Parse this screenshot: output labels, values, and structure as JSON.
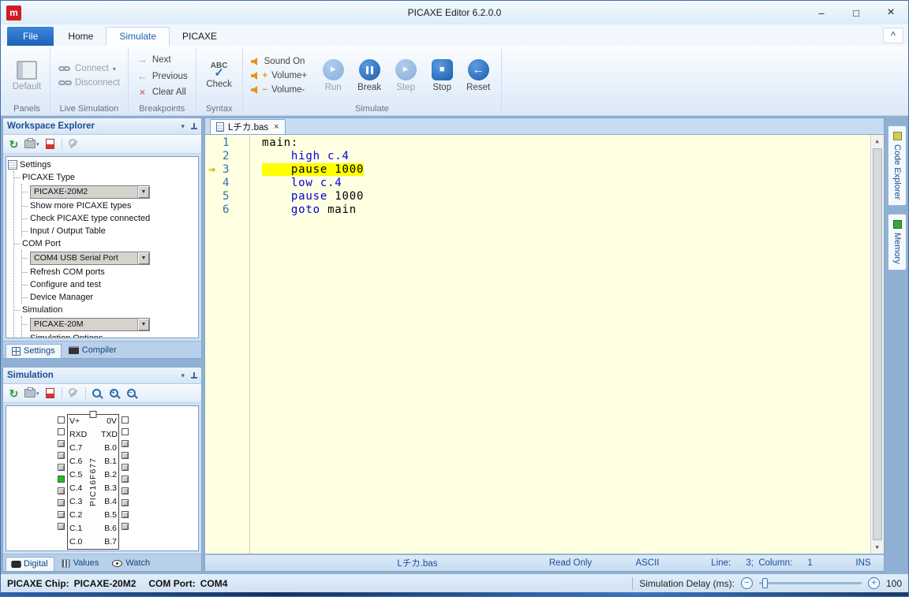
{
  "window": {
    "title": "PICAXE Editor 6.2.0.0"
  },
  "icons": {
    "app_logo": "m",
    "minimize": "–",
    "maximize": "□",
    "close": "×",
    "ribbon_collapse": "^",
    "dropdown": "▼",
    "panel_menu": "▾",
    "connect_caret": "▾",
    "printer_caret": "▾",
    "next": "→",
    "previous": "←",
    "clear_all": "×",
    "check": "✓",
    "run": "►",
    "step": "►",
    "stop": "■",
    "reset": "←",
    "refresh": "↻",
    "scroll_up": "▲",
    "scroll_down": "▼",
    "minus": "−",
    "plus": "+",
    "tab_close": "×",
    "zoom_plus": "+",
    "zoom_minus": "−"
  },
  "colors": {
    "accent_blue": "#1c5cab",
    "editor_bg": "#ffffe1",
    "line_highlight": "#ffff00",
    "keyword_blue": "#0000dd",
    "pin_on_green": "#17c517",
    "file_tab_blue": "#2273cc"
  },
  "ribbon": {
    "tabs": {
      "file": "File",
      "home": "Home",
      "simulate": "Simulate",
      "picaxe": "PICAXE"
    },
    "panels": {
      "default_label": "Default",
      "group_label": "Panels"
    },
    "live_simulation": {
      "connect": "Connect",
      "disconnect": "Disconnect",
      "group_label": "Live Simulation"
    },
    "breakpoints": {
      "next": "Next",
      "previous": "Previous",
      "clear_all": "Clear All",
      "group_label": "Breakpoints"
    },
    "syntax": {
      "abc": "ABC",
      "check": "Check",
      "group_label": "Syntax"
    },
    "simulate_group": {
      "sound_on": "Sound On",
      "volume_up": "Volume+",
      "volume_down": "Volume-",
      "run": "Run",
      "break": "Break",
      "step": "Step",
      "stop": "Stop",
      "reset": "Reset",
      "group_label": "Simulate"
    }
  },
  "workspace": {
    "title": "Workspace Explorer",
    "tree": {
      "root": "Settings",
      "picaxe_type": {
        "label": "PICAXE Type",
        "combo": "PICAXE-20M2",
        "items": [
          "Show more PICAXE types",
          "Check PICAXE type connected",
          "Input / Output Table"
        ]
      },
      "com_port": {
        "label": "COM Port",
        "combo": "COM4 USB Serial Port",
        "items": [
          "Refresh COM ports",
          "Configure and test",
          "Device Manager"
        ]
      },
      "simulation": {
        "label": "Simulation",
        "combo": "PICAXE-20M",
        "items": [
          "Simulation Options"
        ]
      }
    },
    "tabs": {
      "settings": "Settings",
      "compiler": "Compiler"
    }
  },
  "simulation_panel": {
    "title": "Simulation",
    "chip": {
      "name": "PIC16F677",
      "pins": [
        {
          "left": "V+",
          "right": "0V",
          "lstate": "io",
          "rstate": "io"
        },
        {
          "left": "RXD",
          "right": "TXD",
          "lstate": "io",
          "rstate": "io"
        },
        {
          "left": "C.7",
          "right": "B.0",
          "lstate": "off",
          "rstate": "off"
        },
        {
          "left": "C.6",
          "right": "B.1",
          "lstate": "off",
          "rstate": "off"
        },
        {
          "left": "C.5",
          "right": "B.2",
          "lstate": "off",
          "rstate": "off"
        },
        {
          "left": "C.4",
          "right": "B.3",
          "lstate": "on",
          "rstate": "off"
        },
        {
          "left": "C.3",
          "right": "B.4",
          "lstate": "off",
          "rstate": "off"
        },
        {
          "left": "C.2",
          "right": "B.5",
          "lstate": "off",
          "rstate": "off"
        },
        {
          "left": "C.1",
          "right": "B.6",
          "lstate": "off",
          "rstate": "off"
        },
        {
          "left": "C.0",
          "right": "B.7",
          "lstate": "off",
          "rstate": "off"
        }
      ]
    },
    "tabs": {
      "digital": "Digital",
      "values": "Values",
      "watch": "Watch"
    }
  },
  "editor": {
    "tab": {
      "filename": "Lチカ.bas"
    },
    "code": {
      "lines": [
        {
          "num": "1",
          "kw": "",
          "rest": "main:",
          "highlight": "",
          "marker": ""
        },
        {
          "num": "2",
          "kw": "    high c.4",
          "rest": "",
          "highlight": "",
          "marker": ""
        },
        {
          "num": "3",
          "kw": "",
          "rest": "    pause 1000",
          "highlight": "hl",
          "marker": "current"
        },
        {
          "num": "4",
          "kw": "    low c.4",
          "rest": "",
          "highlight": "",
          "marker": ""
        },
        {
          "num": "5",
          "kw": "    pause ",
          "rest": "1000",
          "highlight": "",
          "marker": ""
        },
        {
          "num": "6",
          "kw": "    goto ",
          "rest": "main",
          "highlight": "",
          "marker": ""
        }
      ]
    },
    "status": {
      "filename": "Lチカ.bas",
      "readonly": "Read Only",
      "encoding": "ASCII",
      "position": "Line:      3;  Column:      1",
      "mode": "INS"
    }
  },
  "right_tabs": {
    "code_explorer": "Code Explorer",
    "memory": "Memory"
  },
  "statusbar": {
    "chip_label": "PICAXE Chip:",
    "chip_value": "PICAXE-20M2",
    "com_label": "COM Port:",
    "com_value": "COM4",
    "delay_label": "Simulation Delay (ms):",
    "delay_value": "100"
  }
}
